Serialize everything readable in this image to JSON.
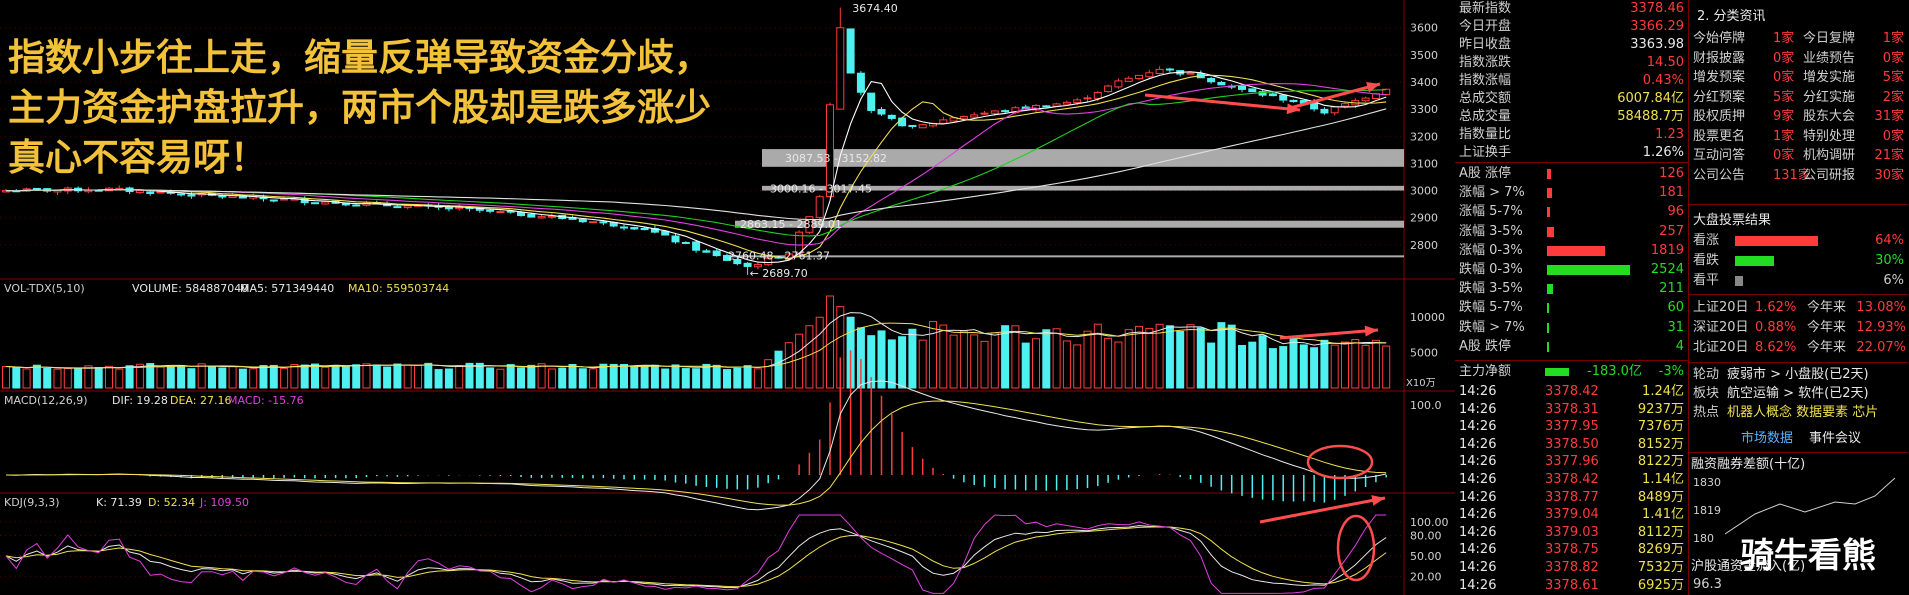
{
  "headline": [
    "指数小步往上走，缩量反弹导致资金分歧，",
    "主力资金护盘拉升，两市个股却是跌多涨少",
    "真心不容易呀！"
  ],
  "watermark": "骑牛看熊",
  "colors": {
    "up": "#ff3b3b",
    "down": "#4ef0f0",
    "ma5": "#ffffff",
    "ma10": "#f0e050",
    "ma20": "#e040e0",
    "ma30": "#20d020",
    "ma60": "#e0e0e0",
    "band": "#c8c8c8",
    "accent": "#f2c23a",
    "arrow": "#ff4d4d"
  },
  "chart_data": [
    {
      "type": "candlestick",
      "name": "上证指数日K",
      "ylim": [
        2700,
        3680
      ],
      "y_ticks": [
        "3600",
        "3500",
        "3400",
        "3300",
        "3200",
        "3100",
        "3000",
        "2900",
        "2800"
      ],
      "annotations": [
        "3674.40",
        "2689.70",
        "3087.53 - 3152.82",
        "3000.16 - 3017.45",
        "2863.15 - 2889.01",
        "2760.48 - 2761.37"
      ],
      "bands": [
        [
          3087.53,
          3152.82
        ],
        [
          3000.16,
          3017.45
        ],
        [
          2863.15,
          2889.01
        ],
        [
          2760.48,
          2761.37
        ]
      ]
    },
    {
      "type": "bar",
      "name": "VOL-TDX(5,10)",
      "legend": {
        "title": "VOL-TDX(5,10)",
        "volume": "VOLUME: 584887040",
        "ma5": "MA5: 571349440",
        "ma10": "MA10: 559503744"
      },
      "y_ticks": [
        "10000",
        "5000"
      ],
      "unit": "X10万"
    },
    {
      "type": "line",
      "name": "MACD(12,26,9)",
      "legend": {
        "title": "MACD(12,26,9)",
        "dif": "DIF: 19.28",
        "dea": "DEA: 27.16",
        "macd": "MACD: -15.76"
      },
      "y_ticks": [
        "100.0"
      ]
    },
    {
      "type": "line",
      "name": "KDJ(9,3,3)",
      "legend": {
        "title": "KDJ(9,3,3)",
        "k": "K: 71.39",
        "d": "D: 52.34",
        "j": "J: 109.50"
      },
      "y_ticks": [
        "100.00",
        "80.00",
        "50.00",
        "20.00"
      ]
    }
  ],
  "index_stats": [
    {
      "label": "最新指数",
      "value": "3378.46",
      "color": "red"
    },
    {
      "label": "今日开盘",
      "value": "3366.29",
      "color": "red"
    },
    {
      "label": "昨日收盘",
      "value": "3363.98",
      "color": "white"
    },
    {
      "label": "指数涨跌",
      "value": "14.50",
      "color": "red"
    },
    {
      "label": "指数涨幅",
      "value": "0.43%",
      "color": "red"
    },
    {
      "label": "总成交额",
      "value": "6007.84亿",
      "color": "yellow"
    },
    {
      "label": "总成交量",
      "value": "58488.7万",
      "color": "yellow"
    },
    {
      "label": "指数量比",
      "value": "1.23",
      "color": "red"
    },
    {
      "label": "上证换手",
      "value": "1.26%",
      "color": "white"
    }
  ],
  "breadth": [
    {
      "label": "A股 涨停",
      "value": "126",
      "color": "red",
      "bar": 0.04
    },
    {
      "label": "涨幅 > 7%",
      "value": "181",
      "color": "red",
      "bar": 0.05
    },
    {
      "label": "涨幅 5-7%",
      "value": "96",
      "color": "red",
      "bar": 0.03
    },
    {
      "label": "涨幅 3-5%",
      "value": "257",
      "color": "red",
      "bar": 0.07
    },
    {
      "label": "涨幅 0-3%",
      "value": "1819",
      "color": "red",
      "bar": 0.58
    },
    {
      "label": "跌幅 0-3%",
      "value": "2524",
      "color": "green",
      "bar": 0.83
    },
    {
      "label": "跌幅 3-5%",
      "value": "211",
      "color": "green",
      "bar": 0.06
    },
    {
      "label": "跌幅 5-7%",
      "value": "60",
      "color": "green",
      "bar": 0.01
    },
    {
      "label": "跌幅 > 7%",
      "value": "31",
      "color": "green",
      "bar": 0.01
    },
    {
      "label": "A股 跌停",
      "value": "4",
      "color": "green",
      "bar": 0.005
    }
  ],
  "main_flow": {
    "label": "主力净额",
    "value": "-183.0亿",
    "pct": "-3%"
  },
  "ticks": [
    {
      "time": "14:26",
      "price": "3378.42",
      "vol": "1.24亿"
    },
    {
      "time": "14:26",
      "price": "3378.31",
      "vol": "9237万"
    },
    {
      "time": "14:26",
      "price": "3377.95",
      "vol": "7376万"
    },
    {
      "time": "14:26",
      "price": "3378.50",
      "vol": "8152万"
    },
    {
      "time": "14:26",
      "price": "3377.96",
      "vol": "8122万"
    },
    {
      "time": "14:26",
      "price": "3378.42",
      "vol": "1.14亿"
    },
    {
      "time": "14:26",
      "price": "3378.77",
      "vol": "8489万"
    },
    {
      "time": "14:26",
      "price": "3379.04",
      "vol": "1.41亿"
    },
    {
      "time": "14:26",
      "price": "3379.03",
      "vol": "8112万"
    },
    {
      "time": "14:26",
      "price": "3378.75",
      "vol": "8269万"
    },
    {
      "time": "14:26",
      "price": "3378.82",
      "vol": "7532万"
    },
    {
      "time": "14:26",
      "price": "3378.61",
      "vol": "6925万"
    }
  ],
  "news_tab": "2. 分类资讯",
  "events": [
    {
      "a_label": "今始停牌",
      "a_val": "1家",
      "b_label": "今日复牌",
      "b_val": "1家"
    },
    {
      "a_label": "财报披露",
      "a_val": "0家",
      "b_label": "业绩预告",
      "b_val": "0家"
    },
    {
      "a_label": "增发预案",
      "a_val": "0家",
      "b_label": "增发实施",
      "b_val": "5家"
    },
    {
      "a_label": "分红预案",
      "a_val": "5家",
      "b_label": "分红实施",
      "b_val": "2家"
    },
    {
      "a_label": "股权质押",
      "a_val": "9家",
      "b_label": "股东大会",
      "b_val": "31家"
    },
    {
      "a_label": "股票更名",
      "a_val": "1家",
      "b_label": "特别处理",
      "b_val": "0家"
    },
    {
      "a_label": "互动问答",
      "a_val": "0家",
      "b_label": "机构调研",
      "b_val": "21家"
    },
    {
      "a_label": "公司公告",
      "a_val": "131家",
      "b_label": "公司研报",
      "b_val": "30家"
    }
  ],
  "vote": {
    "title": "大盘投票结果",
    "items": [
      {
        "label": "看涨",
        "pct": "64%",
        "frac": 0.64,
        "color": "#ff3b3b"
      },
      {
        "label": "看跌",
        "pct": "30%",
        "frac": 0.3,
        "color": "#22dd22"
      },
      {
        "label": "看平",
        "pct": "6%",
        "frac": 0.06,
        "color": "#888888"
      }
    ]
  },
  "returns": [
    {
      "label": "上证20日",
      "v20": "1.62%",
      "ytd_label": "今年来",
      "ytd": "13.08%"
    },
    {
      "label": "深证20日",
      "v20": "0.88%",
      "ytd_label": "今年来",
      "ytd": "12.93%"
    },
    {
      "label": "北证20日",
      "v20": "8.62%",
      "ytd_label": "今年来",
      "ytd": "22.07%"
    }
  ],
  "rotation": [
    {
      "key": "轮动",
      "text": "疲弱市 > 小盘股(已2天)"
    },
    {
      "key": "板块",
      "text": "航空运输 > 软件(已2天)"
    },
    {
      "key": "热点",
      "text": "机器人概念 数据要素 芯片"
    }
  ],
  "tabs": {
    "market": "市场数据",
    "calendar": "事件会议"
  },
  "margin": {
    "title": "融资融券差额(十亿)",
    "y_ticks": [
      "1830",
      "1819",
      "180"
    ],
    "bottom_title": "沪股通资金流入(亿)",
    "bottom_tick": "96.3"
  }
}
